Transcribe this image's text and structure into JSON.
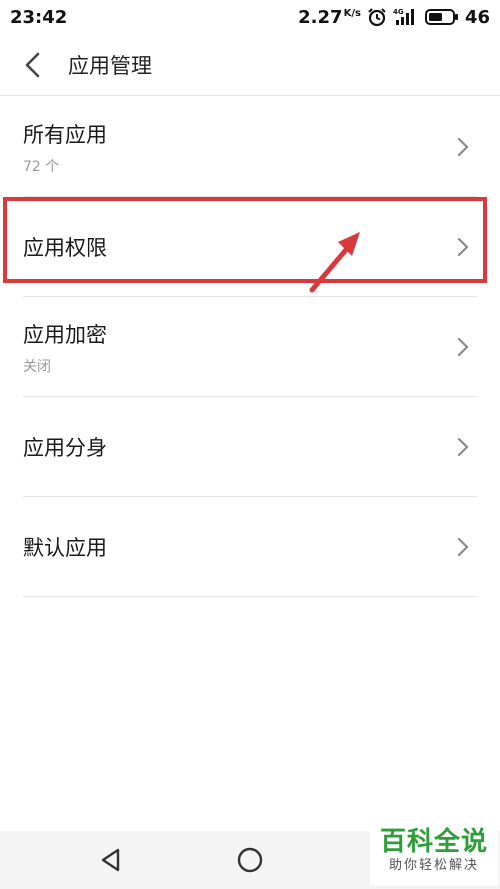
{
  "status_bar": {
    "time": "23:42",
    "speed": "2.27",
    "speed_unit": "K/s",
    "network": "4G",
    "battery": "46"
  },
  "header": {
    "title": "应用管理"
  },
  "list": [
    {
      "title": "所有应用",
      "subtitle": "72 个"
    },
    {
      "title": "应用权限",
      "subtitle": ""
    },
    {
      "title": "应用加密",
      "subtitle": "关闭"
    },
    {
      "title": "应用分身",
      "subtitle": ""
    },
    {
      "title": "默认应用",
      "subtitle": ""
    }
  ],
  "watermark": {
    "title": "百科全说",
    "subtitle": "助你轻松解决"
  },
  "colors": {
    "highlight": "#d9393b",
    "watermark_green": "#2f9d3a"
  }
}
